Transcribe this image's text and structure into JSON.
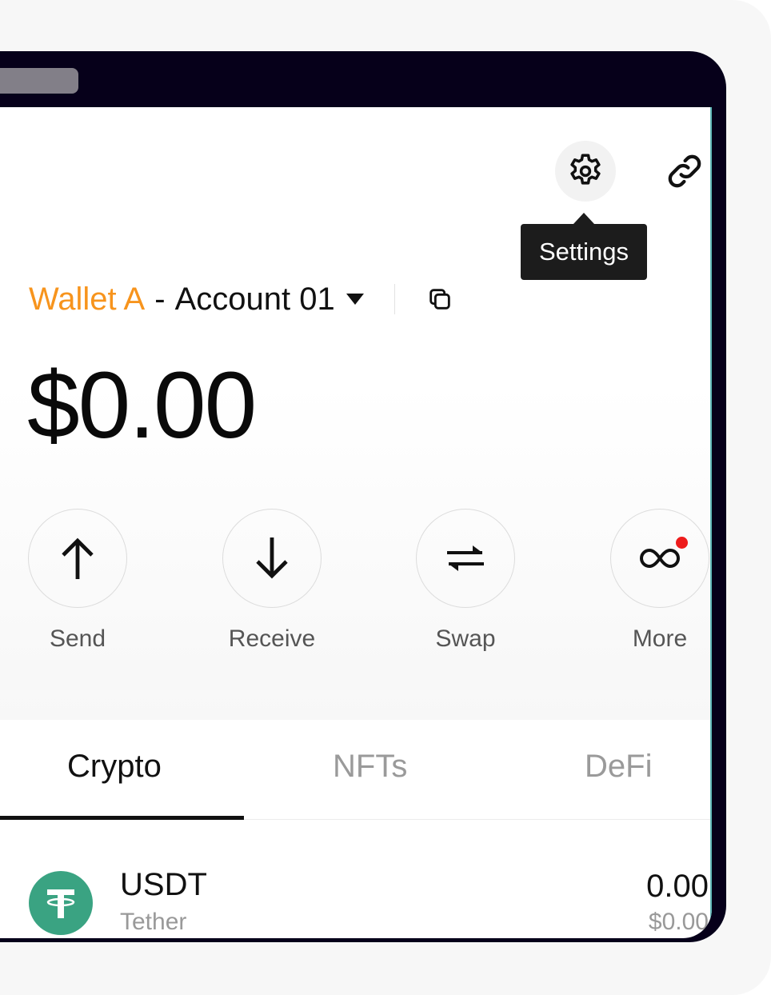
{
  "header": {
    "settings_tooltip": "Settings",
    "icons": [
      "gear-icon",
      "link-icon"
    ]
  },
  "account": {
    "wallet_name": "Wallet A",
    "separator": "-",
    "account_name": "Account 01"
  },
  "balance": "$0.00",
  "actions": [
    {
      "label": "Send",
      "icon": "arrow-up-icon"
    },
    {
      "label": "Receive",
      "icon": "arrow-down-icon"
    },
    {
      "label": "Swap",
      "icon": "swap-arrows-icon"
    },
    {
      "label": "More",
      "icon": "infinity-icon",
      "badge": true
    }
  ],
  "tabs": [
    {
      "label": "Crypto",
      "active": true
    },
    {
      "label": "NFTs",
      "active": false
    },
    {
      "label": "DeFi",
      "active": false
    }
  ],
  "tokens": [
    {
      "symbol": "USDT",
      "name": "Tether",
      "amount": "0.00",
      "value": "$0.00",
      "color": "#3aa382"
    }
  ],
  "colors": {
    "wallet_accent": "#f7941d",
    "frame": "#06001a",
    "badge": "#ee1c1c"
  }
}
